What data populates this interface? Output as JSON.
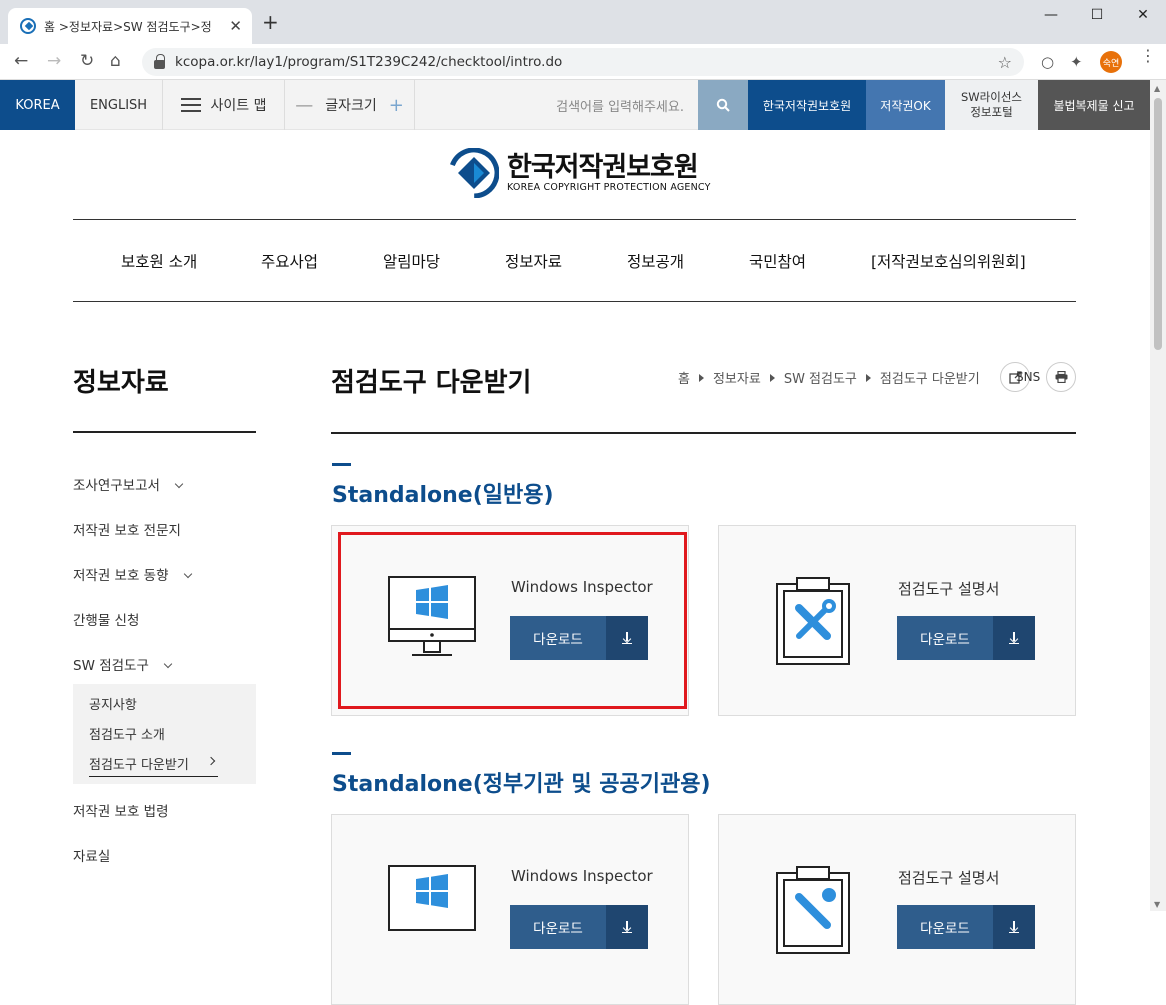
{
  "browser": {
    "tab_title": "홈 >정보자료>SW 점검도구>정",
    "url": "kcopa.or.kr/lay1/program/S1T239C242/checktool/intro.do",
    "profile_label": "숙연"
  },
  "util": {
    "korea": "KOREA",
    "english": "ENGLISH",
    "sitemap": "사이트 맵",
    "font_size": "글자크기",
    "search_placeholder": "검색어를 입력해주세요.",
    "kcopa": "한국저작권보호원",
    "copyright_ok": "저작권OK",
    "sw_portal_line1": "SW라이선스",
    "sw_portal_line2": "정보포털",
    "illegal_report": "불법복제물 신고"
  },
  "logo": {
    "name_ko": "한국저작권보호원",
    "name_en": "KOREA COPYRIGHT PROTECTION AGENCY"
  },
  "gnb": [
    "보호원 소개",
    "주요사업",
    "알림마당",
    "정보자료",
    "정보공개",
    "국민참여",
    "[저작권보호심의위원회]"
  ],
  "lnb": {
    "title": "정보자료",
    "items": [
      "조사연구보고서",
      "저작권 보호 전문지",
      "저작권 보호 동향",
      "간행물 신청",
      "SW 점검도구",
      "저작권 보호 법령",
      "자료실"
    ],
    "sub_items": [
      "공지사항",
      "점검도구 소개",
      "점검도구 다운받기"
    ]
  },
  "content": {
    "page_title": "점검도구 다운받기",
    "breadcrumb": [
      "홈",
      "정보자료",
      "SW 점검도구",
      "점검도구 다운받기"
    ],
    "sns": "SNS",
    "sections": [
      {
        "title": "Standalone(일반용)",
        "cards": [
          {
            "name": "Windows Inspector",
            "button": "다운로드",
            "icon": "windows-monitor-icon"
          },
          {
            "name": "점검도구 설명서",
            "button": "다운로드",
            "icon": "clipboard-tools-icon"
          }
        ]
      },
      {
        "title": "Standalone(정부기관 및 공공기관용)",
        "cards": [
          {
            "name": "Windows Inspector",
            "button": "다운로드",
            "icon": "windows-monitor-icon"
          },
          {
            "name": "점검도구 설명서",
            "button": "다운로드",
            "icon": "clipboard-tools-icon"
          }
        ]
      }
    ]
  },
  "colors": {
    "brand_blue": "#0d4d8c",
    "button_blue": "#2f5d8c",
    "highlight_red": "#e0191e"
  }
}
